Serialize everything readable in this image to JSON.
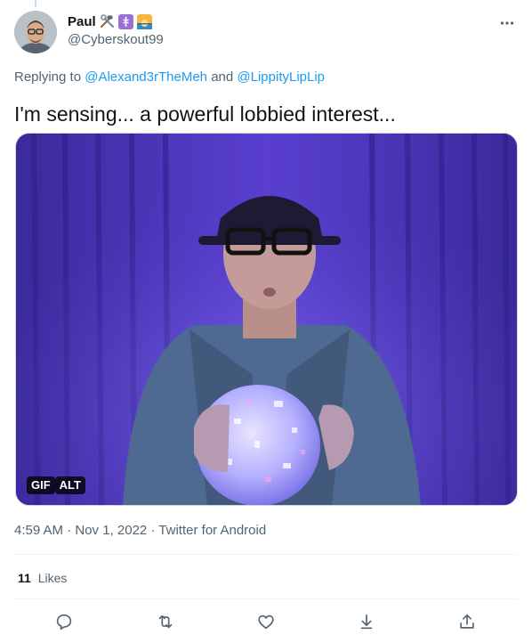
{
  "tweet": {
    "author": {
      "display_name": "Paul",
      "handle": "@Cyberskout99",
      "name_emojis": [
        "hammer-and-wrench-emoji",
        "medical-symbol-emoji",
        "sunrise-emoji"
      ]
    },
    "reply_prefix": "Replying to",
    "reply_to": [
      "@Alexand3rTheMeh",
      "@LippityLipLip"
    ],
    "reply_joiner": "and",
    "text": "I'm sensing... a powerful lobbied interest...",
    "media": {
      "type": "gif",
      "badges": [
        "GIF",
        "ALT"
      ]
    },
    "timestamp": "4:59 AM · Nov 1, 2022 · Twitter for Android",
    "likes": {
      "count": "11",
      "label": "Likes"
    },
    "actions": [
      "reply-icon",
      "retweet-icon",
      "like-icon",
      "bookmark-icon",
      "share-icon"
    ]
  },
  "colors": {
    "link": "#1d9bf0",
    "secondary_text": "#536471",
    "primary_text": "#0f1419",
    "divider": "#eff3f4"
  }
}
